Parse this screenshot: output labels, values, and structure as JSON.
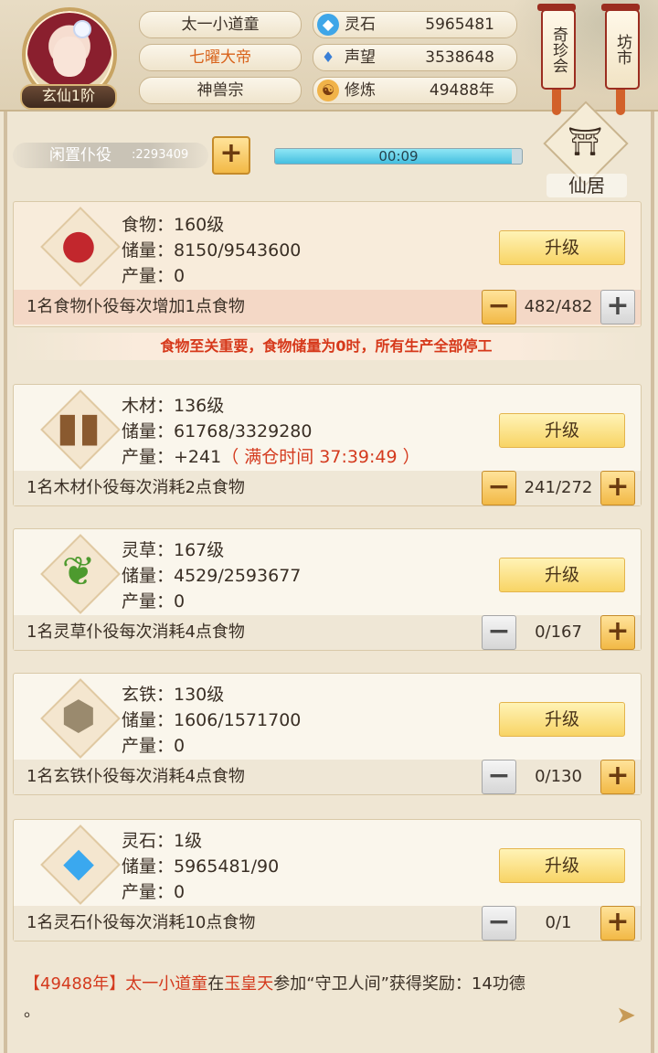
{
  "player": {
    "rank": "玄仙1阶",
    "name": "太一小道童",
    "title": "七曜大帝",
    "sect": "神兽宗"
  },
  "stats": [
    {
      "icon": "spirit-stone-icon",
      "label": "灵石",
      "value": "5965481"
    },
    {
      "icon": "prestige-crystal-icon",
      "label": "声望",
      "value": "3538648"
    },
    {
      "icon": "cultivation-icon",
      "label": "修炼",
      "value": "49488年"
    }
  ],
  "shops": {
    "treasure": "奇珍会",
    "market": "坊市"
  },
  "servants": {
    "idle_label": "闲置仆役",
    "idle_count": ":2293409",
    "timer": "00:09",
    "timer_progress": 0.96
  },
  "residence": {
    "label": "仙居"
  },
  "upgrade_label": "升级",
  "resources": [
    {
      "icon": "raw-meat-icon",
      "name": "食物：160级",
      "storage": "储量：8150/9543600",
      "output": "产量：0",
      "output_extra": "",
      "desc": "1名食物仆役每次增加1点食物",
      "count": "482/482",
      "minus": "−",
      "plus": "+"
    },
    {
      "icon": "wood-logs-icon",
      "name": "木材：136级",
      "storage": "储量：61768/3329280",
      "output": "产量：+241",
      "output_extra": "（ 满仓时间 37:39:49 ）",
      "desc": "1名木材仆役每次消耗2点食物",
      "count": "241/272",
      "minus": "−",
      "plus": "+"
    },
    {
      "icon": "herb-leaf-icon",
      "name": "灵草：167级",
      "storage": "储量：4529/2593677",
      "output": "产量：0",
      "output_extra": "",
      "desc": "1名灵草仆役每次消耗4点食物",
      "count": "0/167",
      "minus": "−",
      "plus": "+"
    },
    {
      "icon": "iron-ore-icon",
      "name": "玄铁：130级",
      "storage": "储量：1606/1571700",
      "output": "产量：0",
      "output_extra": "",
      "desc": "1名玄铁仆役每次消耗4点食物",
      "count": "0/130",
      "minus": "−",
      "plus": "+"
    },
    {
      "icon": "blue-crystal-icon",
      "name": "灵石：1级",
      "storage": "储量：5965481/90",
      "output": "产量：0",
      "output_extra": "",
      "desc": "1名灵石仆役每次消耗10点食物",
      "count": "0/1",
      "minus": "−",
      "plus": "+"
    }
  ],
  "food_warning": "食物至关重要，食物储量为0时，所有生产全部停工",
  "log": {
    "year": "【49488年】",
    "actor": "太一小道童",
    "mid1": "在",
    "place": "玉皇天",
    "mid2": "参加",
    "event": "“守卫人间”",
    "tail": "获得奖励：14功德",
    "end": "。"
  },
  "plus_label": "+",
  "colors": {
    "accent_gold": "#f2b946",
    "warning_red": "#d43a1e",
    "title_orange": "#d8621a",
    "timer_blue": "#45bfe0"
  }
}
